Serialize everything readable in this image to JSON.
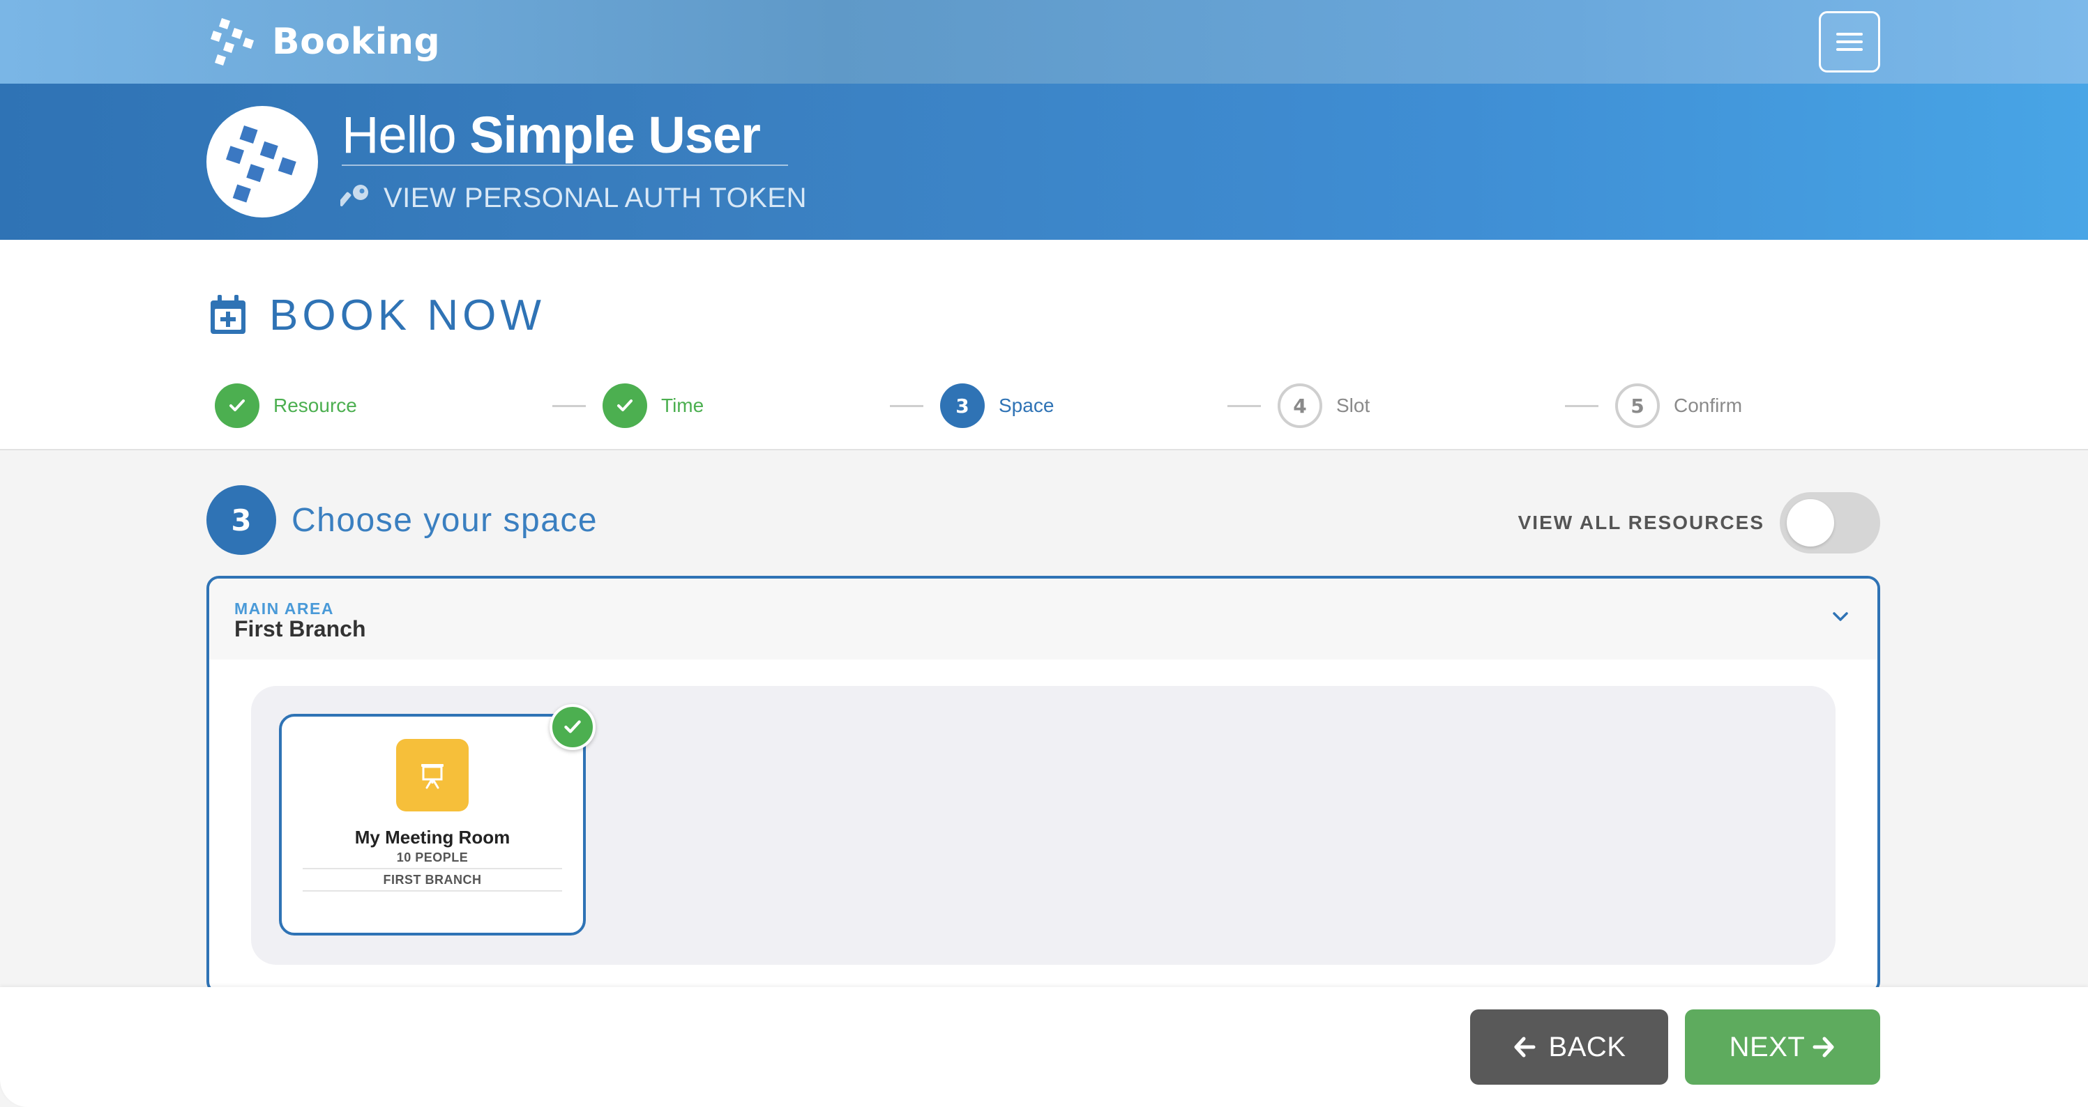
{
  "app": {
    "title": "Booking"
  },
  "header": {
    "menu_icon": "hamburger-menu-icon",
    "logo_icon": "booking-logo-icon"
  },
  "user": {
    "greeting": "Hello",
    "name": "Simple User",
    "auth_link": "VIEW PERSONAL AUTH TOKEN",
    "auth_icon": "key-icon"
  },
  "book": {
    "title": "BOOK NOW",
    "title_icon": "calendar-plus-icon"
  },
  "steps": [
    {
      "number": "1",
      "label": "Resource",
      "state": "done"
    },
    {
      "number": "2",
      "label": "Time",
      "state": "done"
    },
    {
      "number": "3",
      "label": "Space",
      "state": "active"
    },
    {
      "number": "4",
      "label": "Slot",
      "state": "todo"
    },
    {
      "number": "5",
      "label": "Confirm",
      "state": "todo"
    }
  ],
  "choose": {
    "number": "3",
    "title": "Choose your space",
    "view_all_label": "VIEW ALL RESOURCES",
    "view_all_enabled": false
  },
  "area": {
    "caption": "MAIN AREA",
    "name": "First Branch"
  },
  "spaces": [
    {
      "name": "My Meeting Room",
      "capacity": "10 PEOPLE",
      "branch": "FIRST BRANCH",
      "icon": "presentation-board-icon",
      "selected": true
    }
  ],
  "footer": {
    "back_label": "BACK",
    "next_label": "NEXT"
  },
  "colors": {
    "primary": "#2f73b5",
    "success": "#4caf50",
    "space_icon_bg": "#f6bf3a",
    "back_button": "#595959",
    "next_button": "#5eab5e"
  }
}
